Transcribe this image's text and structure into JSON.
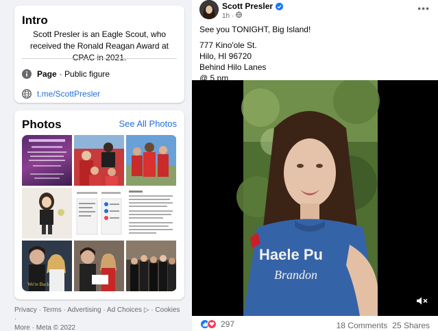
{
  "intro": {
    "title": "Intro",
    "bio": "Scott Presler is an Eagle Scout, who received the Ronald Reagan Award at CPAC in 2021.",
    "category_label": "Page",
    "category_value": "· Public figure",
    "link": "t.me/ScottPresler",
    "icons": {
      "info": "info-icon",
      "web": "globe-icon"
    }
  },
  "photos": {
    "title": "Photos",
    "see_all": "See All Photos",
    "items": [
      "photo-1",
      "photo-2",
      "photo-3",
      "photo-4",
      "photo-5",
      "photo-6",
      "photo-7",
      "photo-8",
      "photo-9"
    ]
  },
  "footer": {
    "privacy": "Privacy",
    "terms": "Terms",
    "advertising": "Advertising",
    "ad_choices": "Ad Choices",
    "cookies": "Cookies",
    "more": "More",
    "meta": "Meta © 2022"
  },
  "post": {
    "author": "Scott Presler",
    "time": "1h",
    "more": "•••",
    "lines": {
      "l1": "See you TONIGHT, Big Island!",
      "l2": "777 Kino'ole St.",
      "l3": "Hilo, HI 96720",
      "l4": "Behind Hilo Lanes",
      "l5": "@ 5 pm"
    },
    "shirt_line1": "Haele Pu",
    "shirt_line2": "Brandon",
    "reactions_count": "297",
    "comments": "18 Comments",
    "shares": "25 Shares"
  },
  "colors": {
    "link": "#216fdb",
    "like": "#1877f2",
    "love": "#f33e58",
    "background": "#f0f2f5"
  }
}
